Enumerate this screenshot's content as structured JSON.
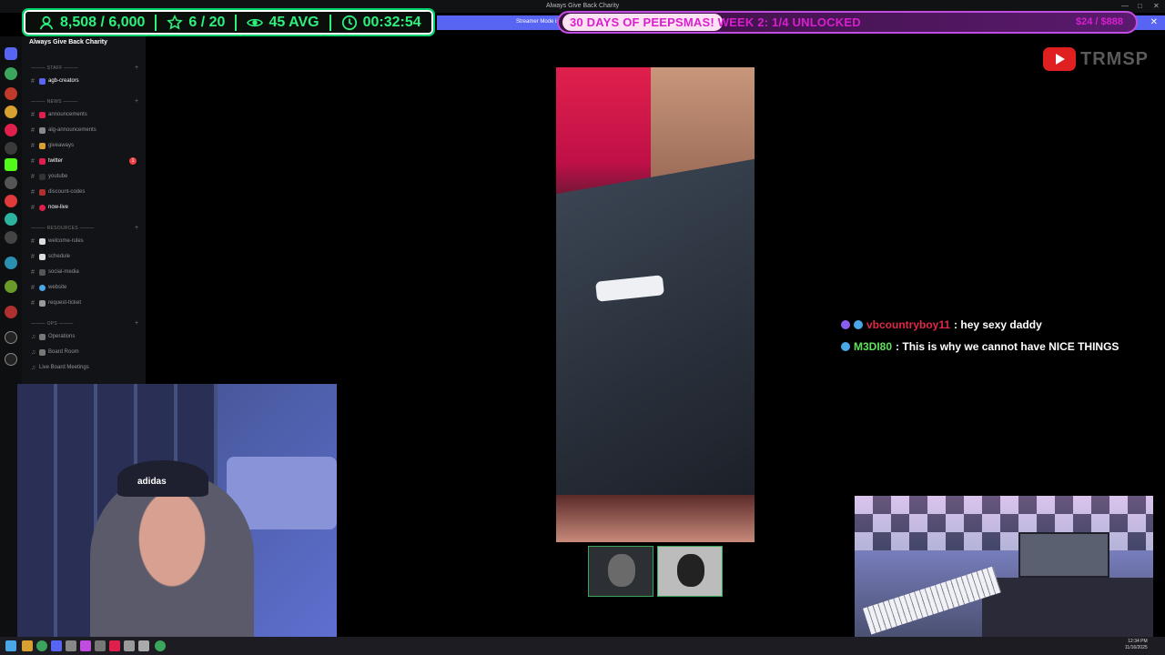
{
  "window": {
    "title": "Always Give Back Charity",
    "controls": [
      "—",
      "□",
      "✕"
    ]
  },
  "stats_overlay": {
    "subs": "8,508 / 6,000",
    "level": "6 / 20",
    "viewers": "45 AVG",
    "uptime": "00:32:54",
    "color": "#2df17c"
  },
  "streamer_bar": {
    "label": "Streamer Mode is",
    "close": "✕"
  },
  "banner": {
    "text": "30 DAYS OF PEEPSMAS! WEEK 2: 1/4 UNLOCKED",
    "right_text": "$24 / $888",
    "color": "#d81fd0"
  },
  "sidebar": {
    "server_name": "Always Give Back Charity",
    "categories": {
      "staff": "STAFF",
      "news": "NEWS",
      "resources": "RESOURCES",
      "ops": "OPS"
    },
    "channels": {
      "agb_creators": "agb-creators",
      "announcements": "announcements",
      "alg_announcements": "alg-announcements",
      "giveaways": "giveaways",
      "twitter": "twitter",
      "youtube": "youtube",
      "discount_codes": "discount-codes",
      "now_live": "now-live",
      "welcome_rules": "welcome-rules",
      "schedule": "schedule",
      "social_media": "social-media",
      "website": "website",
      "request_ticket": "request-ticket",
      "operations": "Operations",
      "board_room": "Board Room",
      "live_board_meetings": "Live Board Meetings"
    },
    "twitter_badge": "1"
  },
  "chat": [
    {
      "user": "vbcountryboy11",
      "message": ": hey sexy daddy",
      "color": "#e0284a",
      "icon_color": "#8a5cf0"
    },
    {
      "user": "M3DI80",
      "message": ": This is why we cannot have NICE THINGS",
      "color": "#5de35a",
      "icon_color": "#4aa8e8"
    }
  ],
  "branding": {
    "handle": "TRMSP",
    "icon": "youtube-icon"
  },
  "webcam_left": {
    "cap_text": "adidas"
  },
  "taskbar": {
    "time": "12:34 PM",
    "date": "11/16/2025"
  }
}
